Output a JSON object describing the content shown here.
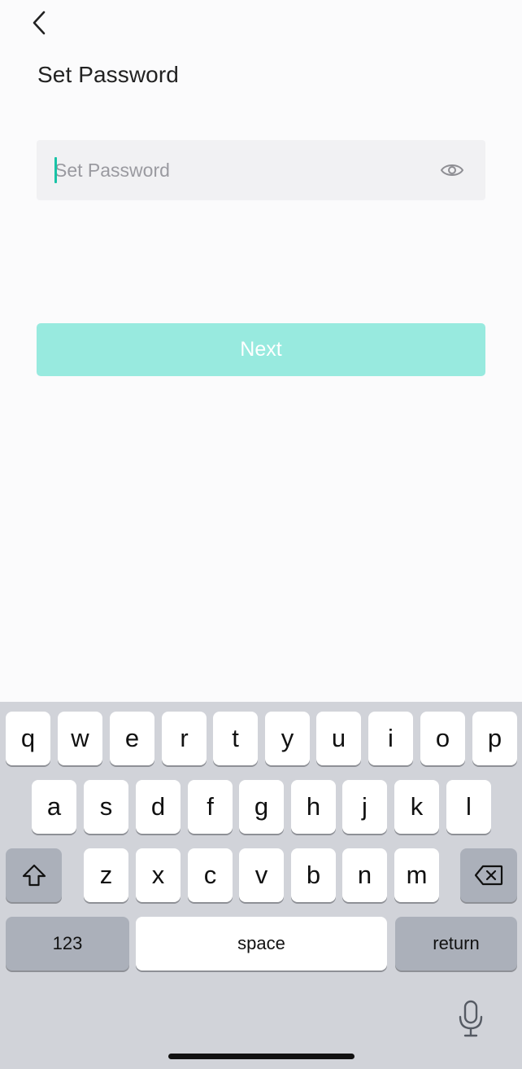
{
  "header": {
    "title": "Set Password"
  },
  "password_field": {
    "value": "",
    "placeholder": "Set Password"
  },
  "next_button": {
    "label": "Next"
  },
  "colors": {
    "accent": "#19c3a6",
    "button_disabled": "#98eadf"
  },
  "keyboard": {
    "row1": [
      "q",
      "w",
      "e",
      "r",
      "t",
      "y",
      "u",
      "i",
      "o",
      "p"
    ],
    "row2": [
      "a",
      "s",
      "d",
      "f",
      "g",
      "h",
      "j",
      "k",
      "l"
    ],
    "row3": [
      "z",
      "x",
      "c",
      "v",
      "b",
      "n",
      "m"
    ],
    "numbers_label": "123",
    "space_label": "space",
    "return_label": "return"
  },
  "icons": {
    "back": "chevron-left-icon",
    "eye": "eye-icon",
    "shift": "shift-icon",
    "delete": "backspace-icon",
    "mic": "microphone-icon"
  }
}
